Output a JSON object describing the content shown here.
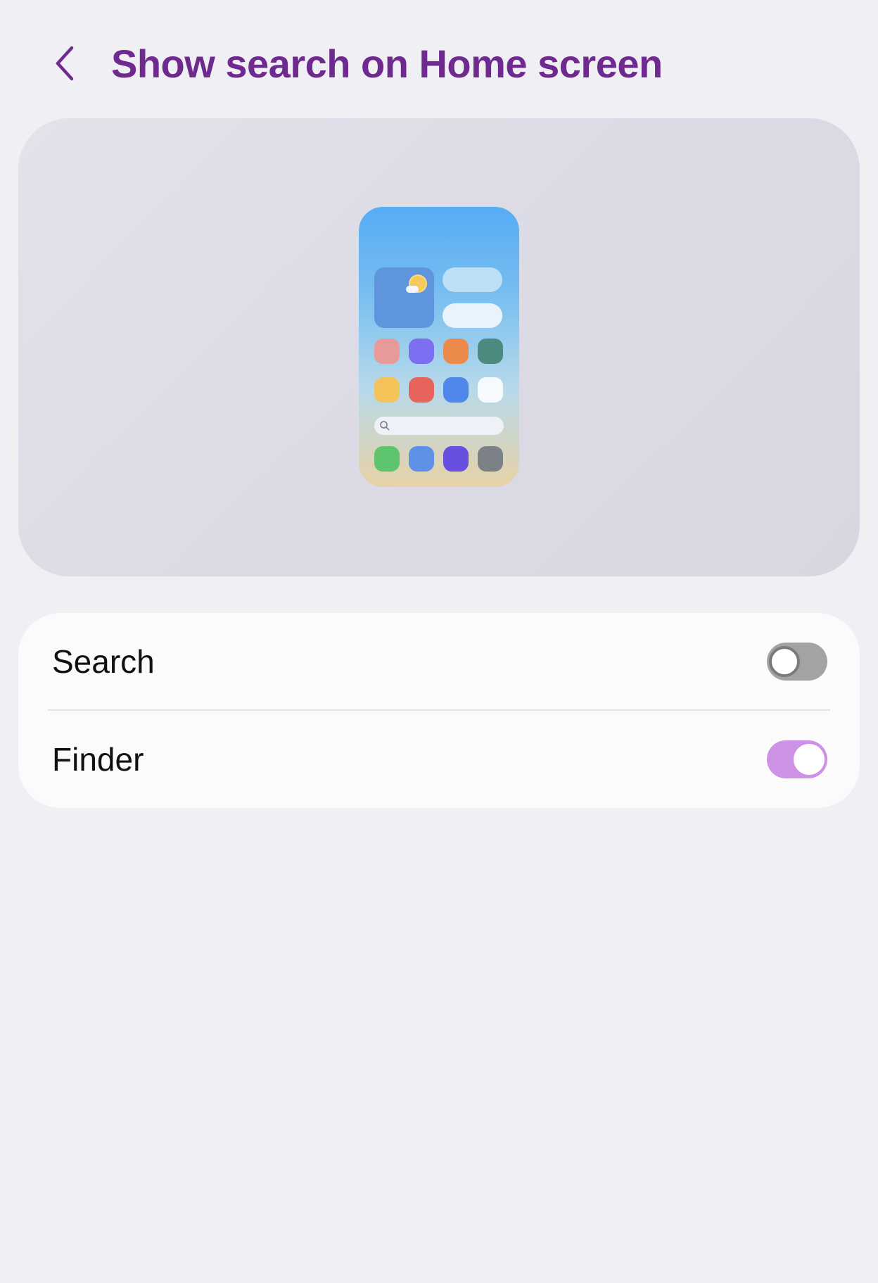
{
  "header": {
    "title": "Show search on Home screen",
    "back_icon": "chevron-left-icon"
  },
  "preview": {
    "description_icon": "phone-home-screen-illustration",
    "search_icon": "search-icon",
    "app_icon_colors": [
      [
        "#e89a9a",
        "#7c6ef0",
        "#ec8a4c",
        "#4c8a80"
      ],
      [
        "#f4c45a",
        "#e7645c",
        "#4e86e9",
        "#f7fafd"
      ],
      [
        "#5fc46e",
        "#5e91e6",
        "#6750e0",
        "#7c8087"
      ]
    ]
  },
  "settings": {
    "items": [
      {
        "label": "Search",
        "enabled": false
      },
      {
        "label": "Finder",
        "enabled": true
      }
    ]
  },
  "colors": {
    "accent": "#6e2a8e",
    "toggle_on": "#cd92e6",
    "toggle_off": "#a3a3a5",
    "background": "#f0eff4"
  }
}
